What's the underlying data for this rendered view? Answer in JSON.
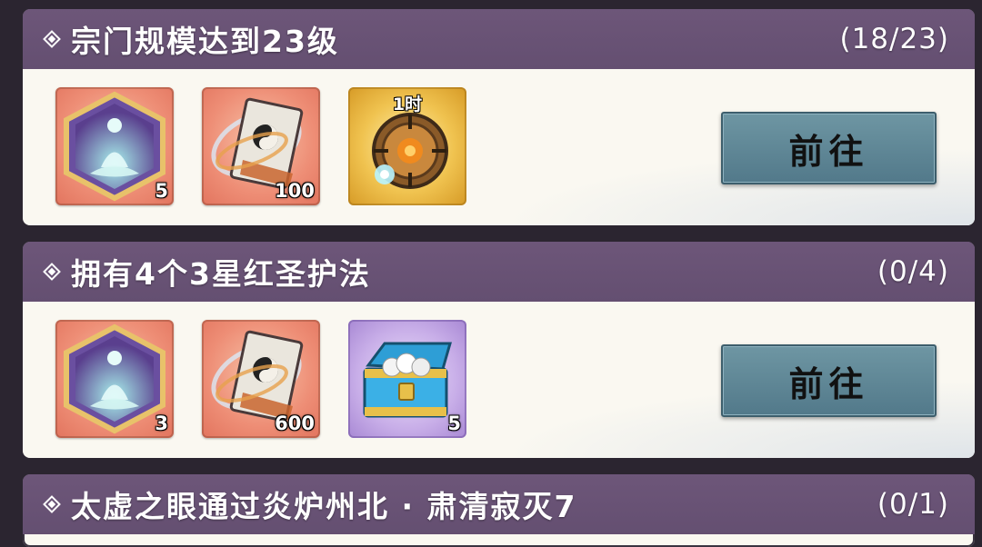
{
  "tasks": [
    {
      "title": "宗门规模达到23级",
      "progress": "(18/23)",
      "button_label": "前往",
      "rewards": [
        {
          "icon": "meditation-figure-icon",
          "count": "5"
        },
        {
          "icon": "yin-yang-book-icon",
          "count": "100"
        },
        {
          "icon": "golden-compass-icon",
          "timer": "1时"
        }
      ]
    },
    {
      "title": "拥有4个3星红圣护法",
      "progress": "(0/4)",
      "button_label": "前往",
      "rewards": [
        {
          "icon": "meditation-figure-icon",
          "count": "3"
        },
        {
          "icon": "yin-yang-book-icon",
          "count": "600"
        },
        {
          "icon": "treasure-chest-icon",
          "count": "5"
        }
      ]
    },
    {
      "title": "太虚之眼通过炎炉州北 · 肃清寂灭7",
      "progress": "(0/1)"
    }
  ]
}
